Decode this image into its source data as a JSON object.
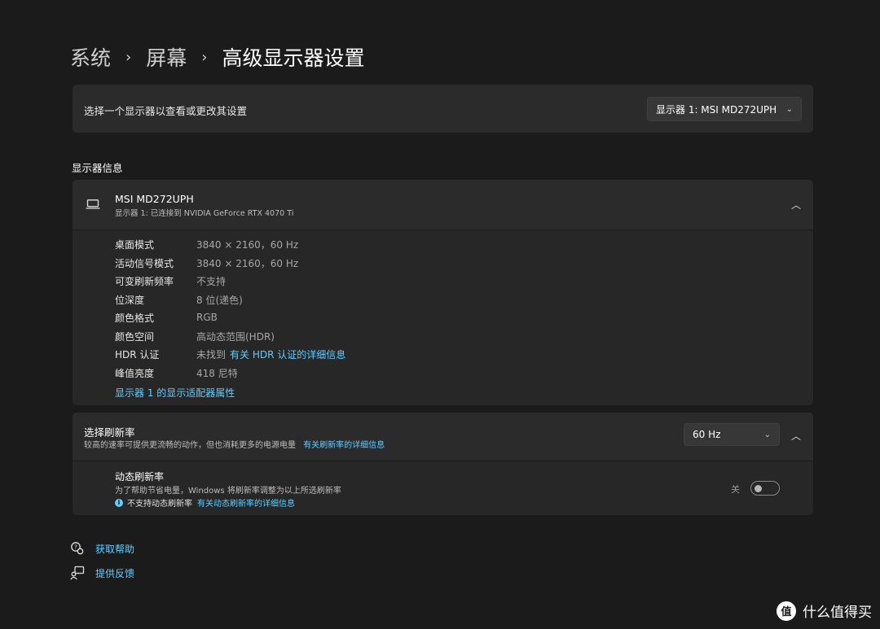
{
  "breadcrumb": {
    "items": [
      "系统",
      "屏幕",
      "高级显示器设置"
    ],
    "separator": "›"
  },
  "monitor_select": {
    "label": "选择一个显示器以查看或更改其设置",
    "selected": "显示器 1: MSI MD272UPH",
    "icon": "chevron-down-icon"
  },
  "display_info": {
    "section_title": "显示器信息",
    "name": "MSI MD272UPH",
    "subtitle": "显示器 1: 已连接到 NVIDIA GeForce RTX 4070 Ti",
    "icon": "laptop-icon",
    "collapse_icon": "chevron-up-icon",
    "rows": [
      {
        "key": "桌面模式",
        "value": "3840 × 2160，60 Hz"
      },
      {
        "key": "活动信号模式",
        "value": "3840 × 2160，60 Hz"
      },
      {
        "key": "可变刷新频率",
        "value": "不支持"
      },
      {
        "key": "位深度",
        "value": "8 位(递色)"
      },
      {
        "key": "颜色格式",
        "value": "RGB"
      },
      {
        "key": "颜色空间",
        "value": "高动态范围(HDR)"
      },
      {
        "key": "HDR 认证",
        "value": "未找到",
        "link": "有关 HDR 认证的详细信息"
      },
      {
        "key": "峰值亮度",
        "value": "418 尼特"
      }
    ],
    "adapter_link": "显示器 1 的显示适配器属性"
  },
  "refresh_rate": {
    "title": "选择刷新率",
    "description": "较高的速率可提供更流畅的动作，但也消耗更多的电源电量",
    "link": "有关刷新率的详细信息",
    "selected": "60 Hz",
    "dynamic": {
      "title": "动态刷新率",
      "description": "为了帮助节省电量，Windows 将刷新率调整为以上所选刷新率",
      "note": "不支持动态刷新率",
      "note_link": "有关动态刷新率的详细信息",
      "toggle_label": "关",
      "toggle_on": false
    }
  },
  "footer": {
    "help": "获取帮助",
    "feedback": "提供反馈"
  },
  "watermark": {
    "logo": "值",
    "text": "什么值得买"
  },
  "colors": {
    "background": "#1b1b1b",
    "card": "#2b2b2b",
    "accent": "#60cdff"
  }
}
